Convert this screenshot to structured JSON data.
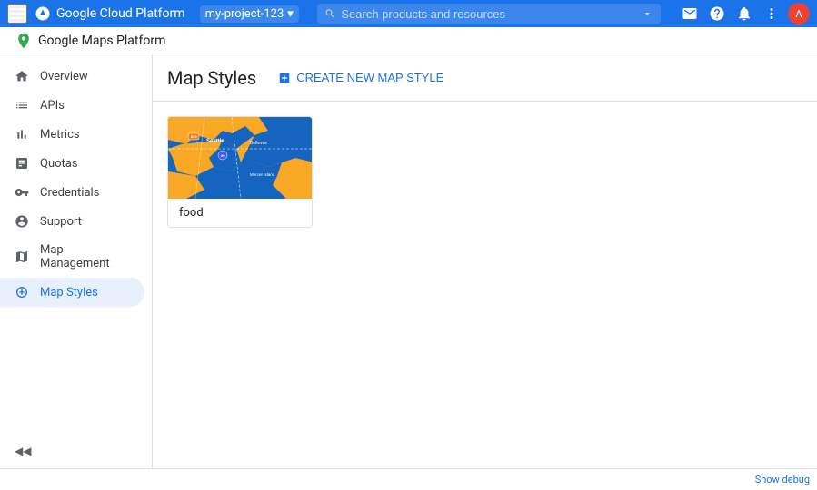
{
  "topHeader": {
    "appTitle": "Google Cloud Platform",
    "projectName": "my-project-123",
    "searchPlaceholder": "Search products and resources",
    "searchDropdownLabel": "▾"
  },
  "secondHeader": {
    "appName": "Google Maps Platform"
  },
  "sidebar": {
    "items": [
      {
        "id": "overview",
        "label": "Overview",
        "icon": "home"
      },
      {
        "id": "apis",
        "label": "APIs",
        "icon": "list"
      },
      {
        "id": "metrics",
        "label": "Metrics",
        "icon": "bar_chart"
      },
      {
        "id": "quotas",
        "label": "Quotas",
        "icon": "storage"
      },
      {
        "id": "credentials",
        "label": "Credentials",
        "icon": "vpn_key"
      },
      {
        "id": "support",
        "label": "Support",
        "icon": "person"
      },
      {
        "id": "map-management",
        "label": "Map Management",
        "icon": "layers"
      },
      {
        "id": "map-styles",
        "label": "Map Styles",
        "icon": "palette",
        "active": true
      }
    ],
    "collapseLabel": "◀"
  },
  "contentHeader": {
    "title": "Map Styles",
    "createButtonLabel": "CREATE NEW MAP STYLE",
    "createButtonIcon": "+"
  },
  "mapStyles": [
    {
      "id": "food-style",
      "name": "food"
    }
  ],
  "bottomBar": {
    "showDebugLabel": "Show debug"
  },
  "icons": {
    "hamburger": "☰",
    "search": "🔍",
    "email": "✉",
    "help": "?",
    "bell": "🔔",
    "more": "⋮",
    "mapPin": "📍",
    "collapse": "◀"
  }
}
